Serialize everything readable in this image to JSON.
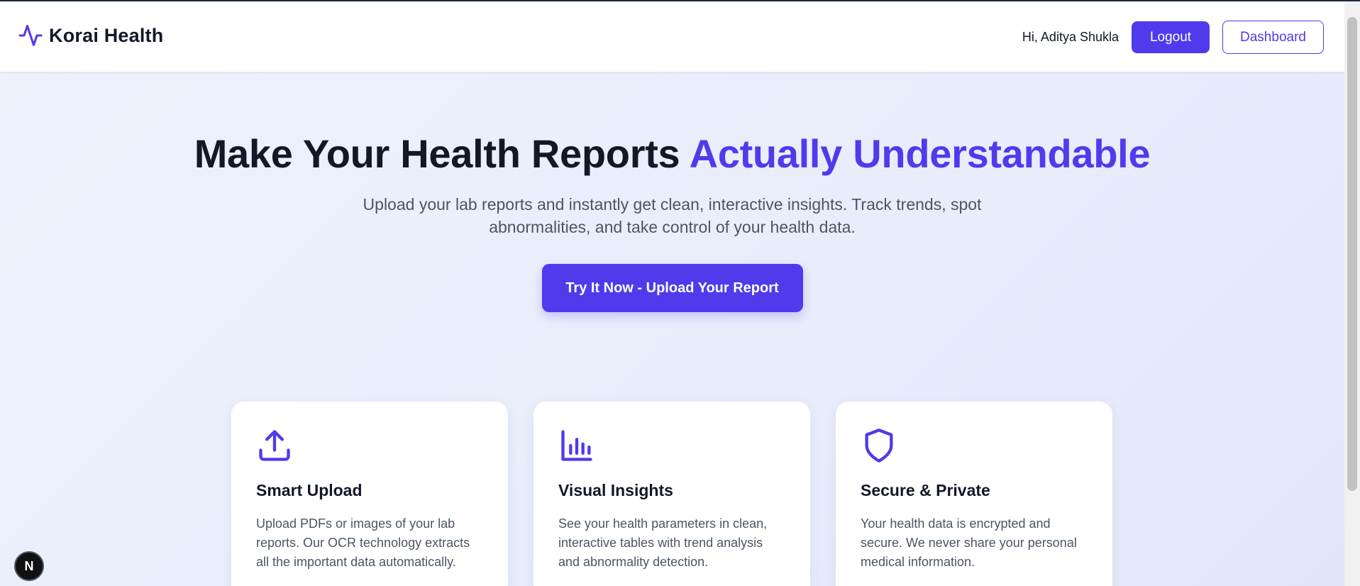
{
  "brand": {
    "name": "Korai Health",
    "icon": "activity-pulse-icon"
  },
  "nav": {
    "greeting": "Hi, Aditya Shukla",
    "logout_label": "Logout",
    "dashboard_label": "Dashboard"
  },
  "hero": {
    "title_part1": "Make Your Health Reports ",
    "title_accent": "Actually Understandable",
    "subtitle": "Upload your lab reports and instantly get clean, interactive insights. Track trends, spot abnormalities, and take control of your health data.",
    "cta_label": "Try It Now - Upload Your Report"
  },
  "features": [
    {
      "icon": "upload-icon",
      "title": "Smart Upload",
      "text": "Upload PDFs or images of your lab reports. Our OCR technology extracts all the important data automatically."
    },
    {
      "icon": "bar-chart-icon",
      "title": "Visual Insights",
      "text": "See your health parameters in clean, interactive tables with trend analysis and abnormality detection."
    },
    {
      "icon": "shield-icon",
      "title": "Secure & Private",
      "text": "Your health data is encrypted and secure. We never share your personal medical information."
    }
  ],
  "dev_badge": {
    "label": "N",
    "icon": "nextjs-icon"
  },
  "colors": {
    "accent": "#4f3bec",
    "heading": "#111827",
    "body_text": "#4b5563",
    "background": "#eef1fc"
  }
}
